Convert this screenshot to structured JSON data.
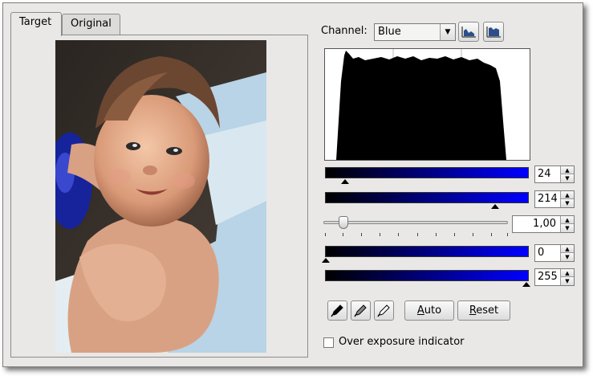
{
  "tabs": [
    {
      "label": "Target",
      "active": true
    },
    {
      "label": "Original",
      "active": false
    }
  ],
  "channel": {
    "label": "Channel:",
    "selected": "Blue"
  },
  "toolbar": {
    "linear_icon": "linear-histogram-icon",
    "log_icon": "logarithmic-histogram-icon"
  },
  "input_levels": {
    "low": "24",
    "high": "214"
  },
  "gamma": {
    "value": "1,00"
  },
  "output_levels": {
    "low": "0",
    "high": "255"
  },
  "buttons": {
    "auto_letter": "A",
    "auto_rest": "uto",
    "reset_letter": "R",
    "reset_rest": "eset"
  },
  "pickers": [
    "black-point-picker-icon",
    "gray-point-picker-icon",
    "white-point-picker-icon"
  ],
  "over_exposure": {
    "label": "Over exposure indicator",
    "checked": false
  },
  "colors": {
    "gradient_start": "#000000",
    "gradient_end": "#0000ff",
    "histogram_fill": "#000000"
  }
}
